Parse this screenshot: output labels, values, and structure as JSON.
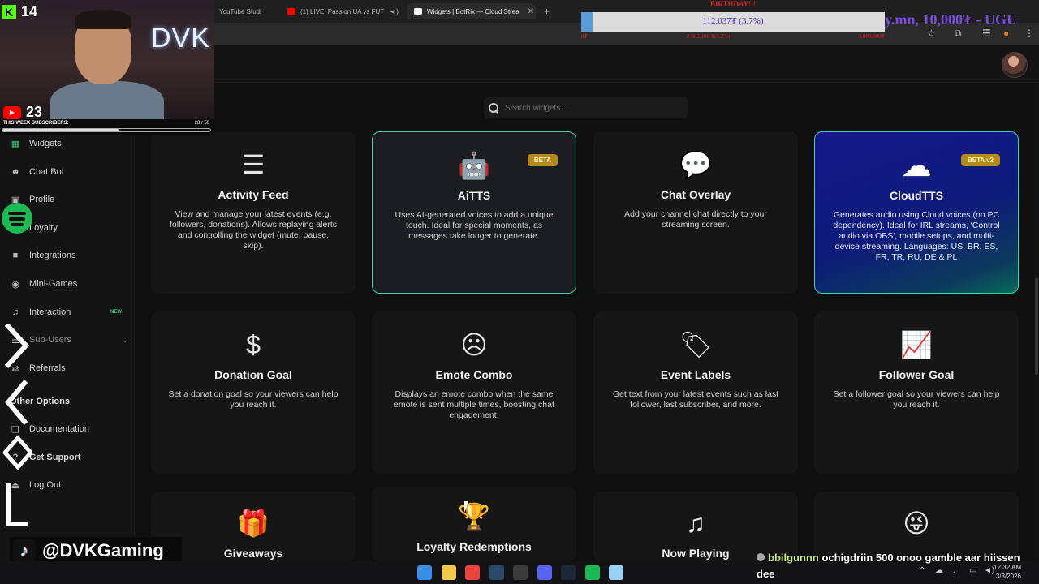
{
  "browser": {
    "tabs": [
      {
        "label": "YouTube Studi",
        "icon_color": "#1f1f1f",
        "active": false
      },
      {
        "label": "(1) LIVE: Passion UA vs FUT",
        "icon_color": "#ff0000",
        "active": false
      },
      {
        "label": "Widgets | BotRix — Cloud Strea",
        "icon_color": "#ffffff",
        "active": true
      }
    ],
    "new_tab": "+",
    "close_glyph": "✕"
  },
  "search": {
    "placeholder": "Search widgets..."
  },
  "sidebar": {
    "items": [
      {
        "label": "Widgets",
        "icon": "grid-icon",
        "glyph": "▦",
        "active": true
      },
      {
        "label": "Chat Bot",
        "icon": "robot-icon",
        "glyph": "☻"
      },
      {
        "label": "Profile",
        "icon": "profile-icon",
        "glyph": "▣"
      },
      {
        "label": "Loyalty",
        "icon": "heart-icon",
        "glyph": "♥"
      },
      {
        "label": "Integrations",
        "icon": "plug-icon",
        "glyph": "■"
      },
      {
        "label": "Mini-Games",
        "icon": "gamepad-icon",
        "glyph": "◉"
      },
      {
        "label": "Interaction",
        "icon": "music-icon",
        "glyph": "♫",
        "badge": "NEW"
      },
      {
        "label": "Sub-Users",
        "icon": "users-icon",
        "glyph": "☰",
        "dim": true
      },
      {
        "label": "Referrals",
        "icon": "share-icon",
        "glyph": "⇄"
      }
    ],
    "other_heading": "Other Options",
    "other_items": [
      {
        "label": "Documentation",
        "icon": "book-icon",
        "glyph": "❑"
      },
      {
        "label": "Get Support",
        "icon": "support-icon",
        "glyph": "?",
        "bold": true
      },
      {
        "label": "Log Out",
        "icon": "logout-icon",
        "glyph": "⏏"
      }
    ]
  },
  "cards": [
    {
      "title": "Activity Feed",
      "desc": "View and manage your latest events (e.g. followers, donations). Allows replaying alerts and controlling the widget (mute, pause, skip).",
      "icon": "list-icon",
      "glyph": "☰",
      "variant": "plain"
    },
    {
      "title": "AiTTS",
      "desc": "Uses AI-generated voices to add a unique touch. Ideal for special moments, as messages take longer to generate.",
      "icon": "robot-icon",
      "glyph": "🤖",
      "variant": "highlight",
      "badge": "BETA"
    },
    {
      "title": "Chat Overlay",
      "desc": "Add your channel chat directly to your streaming screen.",
      "icon": "chat-icon",
      "glyph": "💬",
      "variant": "plain"
    },
    {
      "title": "CloudTTS",
      "desc": "Generates audio using Cloud voices (no PC dependency). Ideal for IRL streams, 'Control audio via OBS', mobile setups, and multi-device streaming. Languages: US, BR, ES, FR, TR, RU, DE & PL",
      "icon": "cloud-icon",
      "glyph": "☁",
      "variant": "cloud",
      "badge": "BETA v2"
    },
    {
      "title": "Donation Goal",
      "desc": "Set a donation goal so your viewers can help you reach it.",
      "icon": "dollar-icon",
      "glyph": "$",
      "variant": "plain"
    },
    {
      "title": "Emote Combo",
      "desc": "Displays an emote combo when the same emote is sent multiple times, boosting chat engagement.",
      "icon": "emote-icon",
      "glyph": "☹",
      "variant": "plain"
    },
    {
      "title": "Event Labels",
      "desc": "Get text from your latest events such as last follower, last subscriber, and more.",
      "icon": "tags-icon",
      "glyph": "🏷",
      "variant": "plain"
    },
    {
      "title": "Follower Goal",
      "desc": "Set a follower goal so your viewers can help you reach it.",
      "icon": "chart-line-icon",
      "glyph": "📈",
      "variant": "plain"
    },
    {
      "title": "Giveaways",
      "desc": "",
      "icon": "gift-icon",
      "glyph": "🎁",
      "variant": "plain"
    },
    {
      "title": "Loyalty Redemptions",
      "desc": "",
      "icon": "trophy-icon",
      "glyph": "🏆",
      "variant": "plain",
      "icon_color": "#3ad07a"
    },
    {
      "title": "Now Playing",
      "desc": "",
      "icon": "music-note-icon",
      "glyph": "♫",
      "variant": "plain"
    },
    {
      "title": "",
      "desc": "",
      "icon": "tongue-emoji-icon",
      "glyph": "😜",
      "variant": "plain"
    }
  ],
  "overlay": {
    "kick_count": "14",
    "youtube_count": "23",
    "neon_text": "DVK",
    "subs_label": "THIS WEEK SUBSCRIBERS:",
    "subs_count": "28  / 50",
    "subs_progress": 0.56,
    "donation_title": "BIRTHDAY!!!",
    "donation_text": "112,037₮ (3.7%)",
    "donation_progress": 0.037,
    "donation_ticks": [
      "0₮",
      "2 982,100 ₮(3.2%)",
      "3,000,000₮"
    ],
    "donation_side": "y.mn, 10,000₮ - UGU",
    "tiktok_handle": "@DVKGaming",
    "chat_user": "bbilgunnn",
    "chat_text": "ochigdriin 500 onoo gamble aar hiissen dee"
  },
  "taskbar": {
    "time": "12:32 AM",
    "date": "3/3/2026",
    "icons": [
      {
        "name": "windows-start-icon",
        "color": "#3a8ee6"
      },
      {
        "name": "file-explorer-icon",
        "color": "#f2c94c"
      },
      {
        "name": "chrome-icon",
        "color": "#e8453c"
      },
      {
        "name": "steam-icon",
        "color": "#2a4a6a"
      },
      {
        "name": "obs-icon",
        "color": "#3b3b3b"
      },
      {
        "name": "discord-icon",
        "color": "#5865f2"
      },
      {
        "name": "steam-alt-icon",
        "color": "#1b2838"
      },
      {
        "name": "spotify-icon",
        "color": "#1db954"
      },
      {
        "name": "app-icon",
        "color": "#9ad0f5"
      }
    ]
  }
}
